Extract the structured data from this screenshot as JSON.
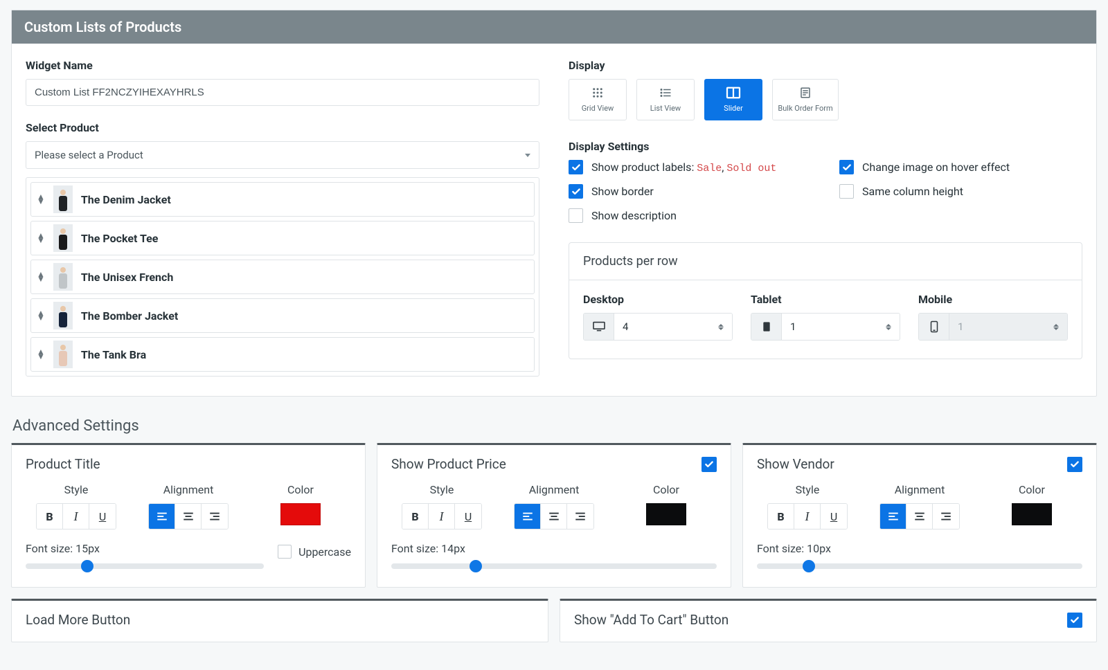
{
  "header": {
    "title": "Custom Lists of Products"
  },
  "widgetName": {
    "label": "Widget Name",
    "value": "Custom List FF2NCZYIHEXAYHRLS"
  },
  "selectProduct": {
    "label": "Select Product",
    "placeholder": "Please select a Product",
    "items": [
      {
        "name": "The Denim Jacket",
        "tint": "#1f2225"
      },
      {
        "name": "The Pocket Tee",
        "tint": "#19191a"
      },
      {
        "name": "The Unisex French",
        "tint": "#c0c5c8"
      },
      {
        "name": "The Bomber Jacket",
        "tint": "#15233a"
      },
      {
        "name": "The Tank Bra",
        "tint": "#e7c8b6"
      }
    ]
  },
  "display": {
    "label": "Display",
    "options": [
      {
        "id": "grid",
        "label": "Grid View",
        "icon": "grid"
      },
      {
        "id": "list",
        "label": "List View",
        "icon": "list"
      },
      {
        "id": "slider",
        "label": "Slider",
        "icon": "columns"
      },
      {
        "id": "bulk",
        "label": "Bulk Order Form",
        "icon": "form"
      }
    ],
    "active": "slider"
  },
  "displaySettings": {
    "label": "Display Settings",
    "labelsPrefix": "Show product labels: ",
    "labelsSale": "Sale",
    "labelsSep": ", ",
    "labelsSold": "Sold out",
    "hoverEffect": "Change image on hover effect",
    "showBorder": "Show border",
    "sameColumn": "Same column height",
    "showDescription": "Show description",
    "checked": {
      "labels": true,
      "hover": true,
      "border": true,
      "sameColumn": false,
      "description": false
    }
  },
  "productsPerRow": {
    "title": "Products per row",
    "desktop": {
      "label": "Desktop",
      "value": "4"
    },
    "tablet": {
      "label": "Tablet",
      "value": "1"
    },
    "mobile": {
      "label": "Mobile",
      "value": "1",
      "disabled": true
    }
  },
  "advanced": {
    "title": "Advanced Settings",
    "cards": {
      "title": {
        "heading": "Product Title",
        "style": "Style",
        "alignment": "Alignment",
        "color": "Color",
        "fontSizeLabel": "Font size: 15px",
        "sliderPct": 26,
        "swatch": "#e40b0b",
        "uppercaseLabel": "Uppercase"
      },
      "price": {
        "heading": "Show Product Price",
        "style": "Style",
        "alignment": "Alignment",
        "color": "Color",
        "fontSizeLabel": "Font size: 14px",
        "sliderPct": 26,
        "swatch": "#0b0c0d"
      },
      "vendor": {
        "heading": "Show Vendor",
        "style": "Style",
        "alignment": "Alignment",
        "color": "Color",
        "fontSizeLabel": "Font size: 10px",
        "sliderPct": 16,
        "swatch": "#0b0c0d"
      }
    },
    "loadMore": {
      "heading": "Load More Button"
    },
    "addToCart": {
      "heading": "Show \"Add To Cart\" Button"
    }
  }
}
